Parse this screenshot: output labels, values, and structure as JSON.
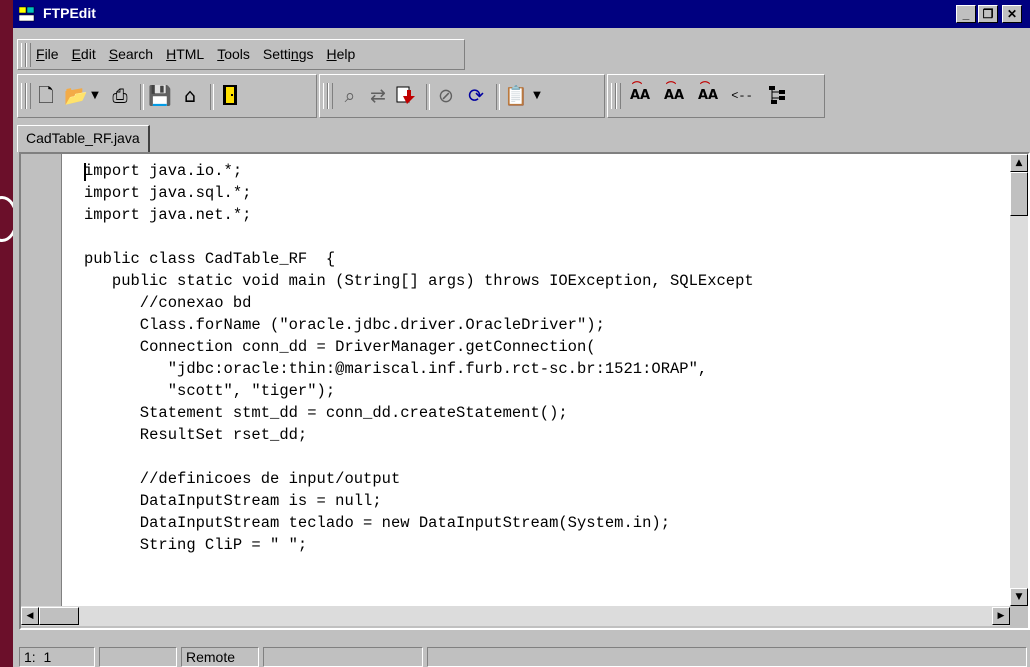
{
  "window": {
    "title": "FTPEdit",
    "minimize_glyph": "_",
    "maximize_glyph": "❐",
    "close_glyph": "✕"
  },
  "menu": {
    "items": [
      {
        "pre": "",
        "key": "F",
        "post": "ile"
      },
      {
        "pre": "",
        "key": "E",
        "post": "dit"
      },
      {
        "pre": "",
        "key": "S",
        "post": "earch"
      },
      {
        "pre": "",
        "key": "H",
        "post": "TML"
      },
      {
        "pre": "",
        "key": "T",
        "post": "ools"
      },
      {
        "pre": "Setti",
        "key": "n",
        "post": "gs"
      },
      {
        "pre": "",
        "key": "H",
        "post": "elp"
      }
    ]
  },
  "toolbar": {
    "icons": [
      "new-file-icon",
      "open-folder-icon",
      "dropdown-arrow-icon",
      "print-icon",
      "save-icon",
      "open-remote-icon",
      "exit-door-icon",
      "find-icon",
      "replace-icon",
      "upload-icon",
      "stop-icon",
      "refresh-icon",
      "clipboard-icon",
      "dropdown-arrow-icon",
      "font-increase-icon",
      "font-decrease-icon",
      "font-size-icon",
      "back-arrow-icon",
      "tree-icon"
    ],
    "back_arrow_text": "<--"
  },
  "tabs": [
    {
      "label": "CadTable_RF.java",
      "active": true
    }
  ],
  "editor": {
    "lines": [
      "import java.io.*;",
      "import java.sql.*;",
      "import java.net.*;",
      "",
      "public class CadTable_RF  {",
      "   public static void main (String[] args) throws IOException, SQLExcept",
      "      //conexao bd",
      "      Class.forName (\"oracle.jdbc.driver.OracleDriver\");",
      "      Connection conn_dd = DriverManager.getConnection(",
      "         \"jdbc:oracle:thin:@mariscal.inf.furb.rct-sc.br:1521:ORAP\",",
      "         \"scott\", \"tiger\");",
      "      Statement stmt_dd = conn_dd.createStatement();",
      "      ResultSet rset_dd;",
      "",
      "      //definicoes de input/output",
      "      DataInputStream is = null;",
      "      DataInputStream teclado = new DataInputStream(System.in);",
      "      String CliP = \" \";"
    ]
  },
  "status": {
    "position": "1:  1",
    "mode": "",
    "location": "Remote",
    "message": ""
  },
  "colors": {
    "background": "#6b0f2a",
    "titlebar": "#000080",
    "chrome": "#c0c0c0"
  }
}
